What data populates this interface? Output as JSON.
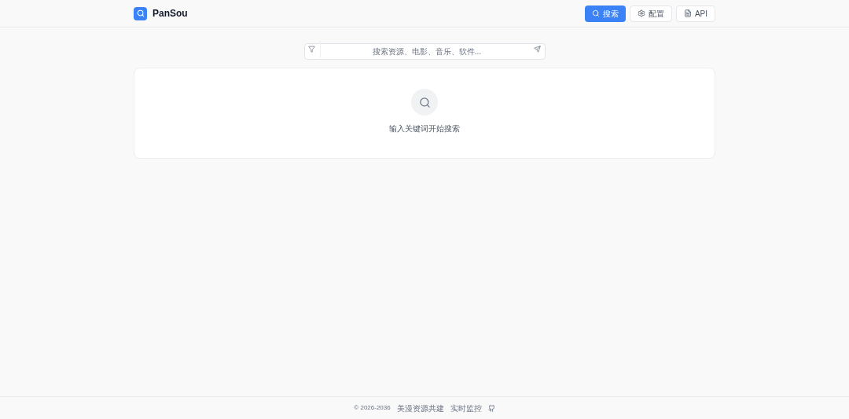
{
  "header": {
    "logo_text": "PanSou",
    "nav": [
      {
        "kind": "search",
        "label": "搜索",
        "selected": true
      },
      {
        "kind": "settings",
        "label": "配置",
        "selected": false
      },
      {
        "kind": "doc",
        "label": "API",
        "selected": false
      }
    ]
  },
  "search": {
    "placeholder": "搜索资源、电影、音乐、软件..."
  },
  "empty_state": {
    "message": "输入关键词开始搜索"
  },
  "footer": {
    "copyright": "© 2026-2036",
    "links": [
      "美漫资源共建",
      "实时监控"
    ]
  }
}
